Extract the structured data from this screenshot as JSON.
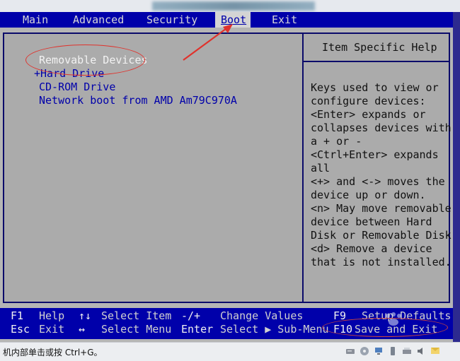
{
  "menu": {
    "items": [
      {
        "label": "Main"
      },
      {
        "label": "Advanced"
      },
      {
        "label": "Security"
      },
      {
        "label": "Boot",
        "active": true
      },
      {
        "label": "Exit"
      }
    ]
  },
  "boot_list": {
    "items": [
      {
        "label": "Removable Devices",
        "selected": true
      },
      {
        "label": "+Hard Drive"
      },
      {
        "label": "CD-ROM Drive"
      },
      {
        "label": "Network boot from AMD Am79C970A"
      }
    ]
  },
  "help": {
    "title": "Item Specific Help",
    "lines": [
      "Keys used to view or",
      "configure devices:",
      "<Enter> expands or",
      "collapses devices with",
      "a + or -",
      "<Ctrl+Enter> expands",
      "all",
      "<+> and <-> moves the",
      "device up or down.",
      "<n> May move removable",
      "device between Hard",
      "Disk or Removable Disk",
      "<d> Remove a device",
      "that is not installed."
    ]
  },
  "footer": {
    "row1": {
      "k1": "F1",
      "d1": "Help",
      "k2": "↑↓",
      "d2": "Select Item",
      "k3": "-/+",
      "d3": "Change Values",
      "k4": "F9",
      "d4": "Setup Defaults"
    },
    "row2": {
      "k1": "Esc",
      "d1": "Exit",
      "k2": "↔",
      "d2": "Select Menu",
      "k3": "Enter",
      "d3": "Select ▶ Sub-Menu",
      "k4": "F10",
      "d4": "Save and Exit"
    }
  },
  "status": {
    "text": "机内部单击或按 Ctrl+G。"
  },
  "colors": {
    "bios_blue": "#0000aa",
    "panel_gray": "#ababab",
    "annotation_red": "#e0322c"
  }
}
